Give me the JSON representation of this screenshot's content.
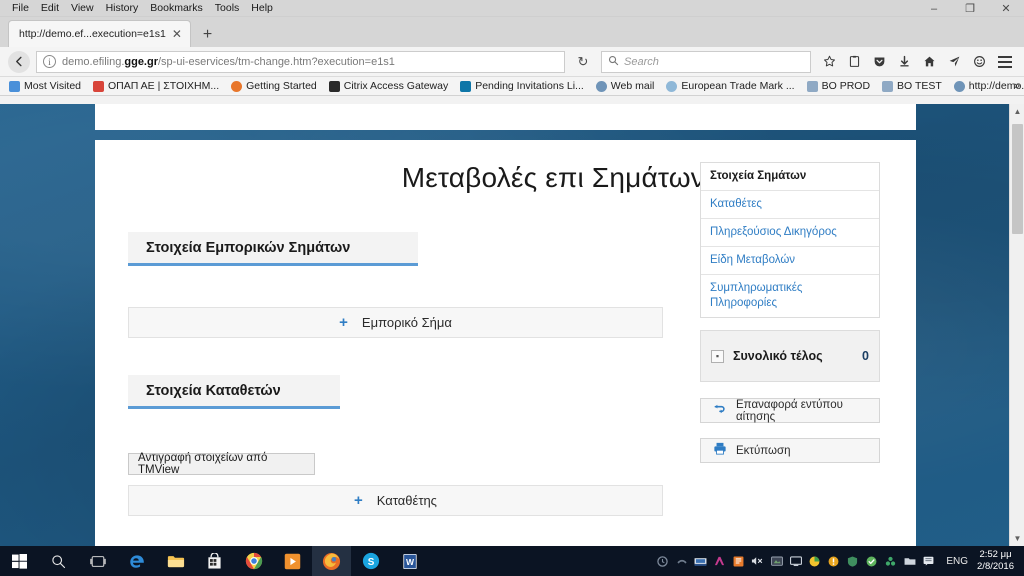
{
  "browser": {
    "menus": [
      "File",
      "Edit",
      "View",
      "History",
      "Bookmarks",
      "Tools",
      "Help"
    ],
    "window_controls": {
      "minimize": "–",
      "restore": "❐",
      "close": "✕"
    },
    "tab": {
      "title": "http://demo.ef...execution=e1s1",
      "close": "✕"
    },
    "new_tab": "+",
    "nav": {
      "back": "←",
      "info": "i",
      "url_prefix": "demo.efiling.",
      "url_domain": "gge.gr",
      "url_suffix": "/sp-ui-eservices/tm-change.htm?execution=e1s1",
      "reload": "↻"
    },
    "search": {
      "placeholder": "Search",
      "icon": "search-icon"
    },
    "toolbar_icons": [
      "star-icon",
      "library-icon",
      "pocket-icon",
      "download-icon",
      "home-icon",
      "send-icon",
      "chat-icon",
      "hamburger-menu-icon"
    ],
    "bookmarks": [
      {
        "label": "Most Visited",
        "color": "#4a90d9"
      },
      {
        "label": "ΟΠΑΠ ΑΕ | ΣΤΟΙΧΗΜ...",
        "color": "#d8453a"
      },
      {
        "label": "Getting Started",
        "color": "#e8762b"
      },
      {
        "label": "Citrix Access Gateway",
        "color": "#2b2b2b"
      },
      {
        "label": "Pending Invitations Li...",
        "color": "#0e76a8"
      },
      {
        "label": "Web mail",
        "color": "#6f94b8"
      },
      {
        "label": "European Trade Mark ...",
        "color": "#8fb8d8"
      },
      {
        "label": "BO PROD",
        "color": "#8fa9c4"
      },
      {
        "label": "BO TEST",
        "color": "#8fa9c4"
      },
      {
        "label": "http://demo.efiling.gg...",
        "color": "#6f94b8"
      }
    ],
    "bookmarks_overflow": "»",
    "scrollbar": {
      "up": "▲",
      "down": "▼"
    }
  },
  "page": {
    "title": "Μεταβολές επι Σημάτων",
    "sections": [
      {
        "heading": "Στοιχεία Εμπορικών Σημάτων"
      },
      {
        "heading": "Στοιχεία Καταθετών"
      }
    ],
    "add_trademark": {
      "plus": "+",
      "label": "Εμπορικό Σήμα"
    },
    "copy_tmview_button": "Αντιγραφή στοιχείων από TMView",
    "add_applicant": {
      "plus": "+",
      "label": "Καταθέτης"
    },
    "sidebar": {
      "items": [
        {
          "label": "Στοιχεία Σημάτων",
          "active": true
        },
        {
          "label": "Καταθέτες",
          "active": false
        },
        {
          "label": "Πληρεξούσιος Δικηγόρος",
          "active": false
        },
        {
          "label": "Είδη Μεταβολών",
          "active": false
        },
        {
          "label": "Συμπληρωματικές Πληροφορίες",
          "active": false
        }
      ]
    },
    "fee": {
      "toggle": "▪",
      "label": "Συνολικό τέλος",
      "value": "0"
    },
    "reset_button": {
      "icon": "reset-icon",
      "label": "Επαναφορά εντύπου αίτησης"
    },
    "print_button": {
      "icon": "printer-icon",
      "label": "Εκτύπωση"
    },
    "accent_color": "#2f7dc4",
    "section_underline_color": "#5b9bd5"
  },
  "taskbar": {
    "items": [
      {
        "name": "start-button",
        "icon": "windows-icon"
      },
      {
        "name": "search-button",
        "icon": "search-icon"
      },
      {
        "name": "task-view-button",
        "icon": "task-view-icon"
      },
      {
        "name": "edge-button",
        "icon": "edge-icon"
      },
      {
        "name": "file-explorer-button",
        "icon": "folder-icon"
      },
      {
        "name": "store-button",
        "icon": "store-icon"
      },
      {
        "name": "chrome-button",
        "icon": "chrome-icon"
      },
      {
        "name": "media-player-button",
        "icon": "media-player-icon"
      },
      {
        "name": "firefox-button",
        "icon": "firefox-icon"
      },
      {
        "name": "skype-button",
        "icon": "skype-icon"
      },
      {
        "name": "word-button",
        "icon": "word-icon"
      }
    ],
    "tray_icons": [
      "onedrive-icon",
      "network-icon",
      "dropbox-icon",
      "adobe-icon",
      "volume-muted-icon",
      "display-icon",
      "monitor-icon",
      "antivirus-icon",
      "update-icon",
      "security-icon",
      "shield-icon",
      "sync-icon",
      "folder-sync-icon",
      "notifications-icon"
    ],
    "language": "ENG",
    "time": "2:52 μμ",
    "date": "2/8/2016"
  }
}
